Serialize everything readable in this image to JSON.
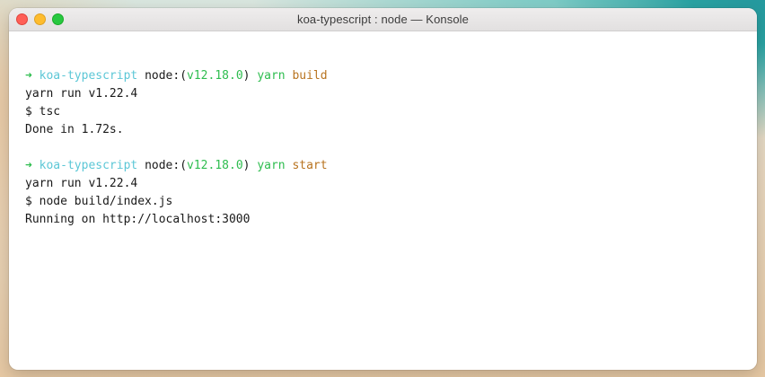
{
  "window": {
    "title": "koa-typescript : node — Konsole"
  },
  "terminal": {
    "blocks": [
      {
        "prompt": {
          "arrow": "➜",
          "dir": "koa-typescript",
          "node_prefix": "node:(",
          "node_version": "v12.18.0",
          "node_suffix": ")",
          "command": "yarn",
          "argument": "build"
        },
        "output": [
          "yarn run v1.22.4",
          "$ tsc",
          "Done in 1.72s."
        ]
      },
      {
        "prompt": {
          "arrow": "➜",
          "dir": "koa-typescript",
          "node_prefix": "node:(",
          "node_version": "v12.18.0",
          "node_suffix": ")",
          "command": "yarn",
          "argument": "start"
        },
        "output": [
          "yarn run v1.22.4",
          "$ node build/index.js",
          "Running on http://localhost:3000"
        ]
      }
    ]
  },
  "colors": {
    "prompt_arrow": "#2ebd4f",
    "directory": "#5cc7d6",
    "node_version": "#2ebd4f",
    "command": "#2ebd4f",
    "argument": "#b8731f",
    "text": "#1a1a1a",
    "close_button": "#ff5f57",
    "minimize_button": "#febc2e",
    "maximize_button": "#28c840"
  }
}
